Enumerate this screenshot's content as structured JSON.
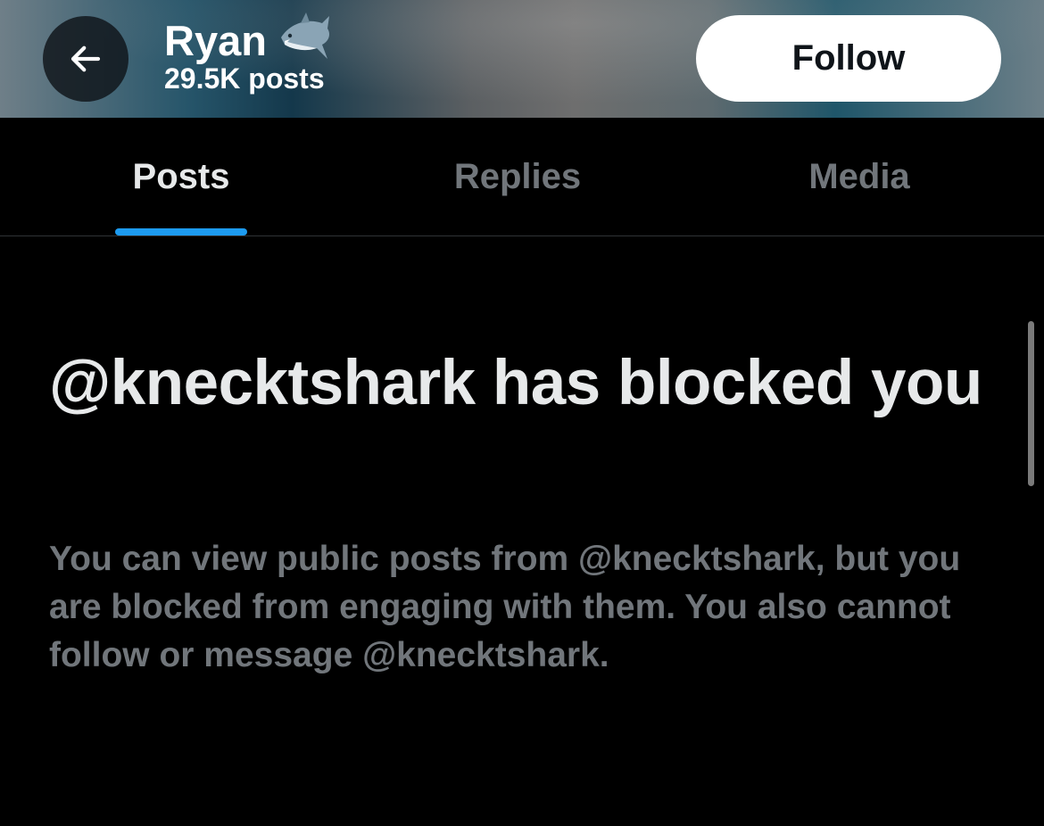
{
  "header": {
    "back_icon": "arrow-left-icon",
    "profile_name": "Ryan",
    "name_emoji_icon": "shark-emoji-icon",
    "posts_count": "29.5K posts",
    "follow_label": "Follow"
  },
  "tabs": [
    {
      "label": "Posts",
      "active": true
    },
    {
      "label": "Replies",
      "active": false
    },
    {
      "label": "Media",
      "active": false
    }
  ],
  "blocked_notice": {
    "title": "@knecktshark has blocked you",
    "body": "You can view public posts from @knecktshark, but you are blocked from engaging with them. You also cannot follow or message @knecktshark."
  },
  "colors": {
    "background": "#000000",
    "primary_text": "#e7e9ea",
    "secondary_text": "#71767b",
    "accent": "#1d9bf0"
  }
}
